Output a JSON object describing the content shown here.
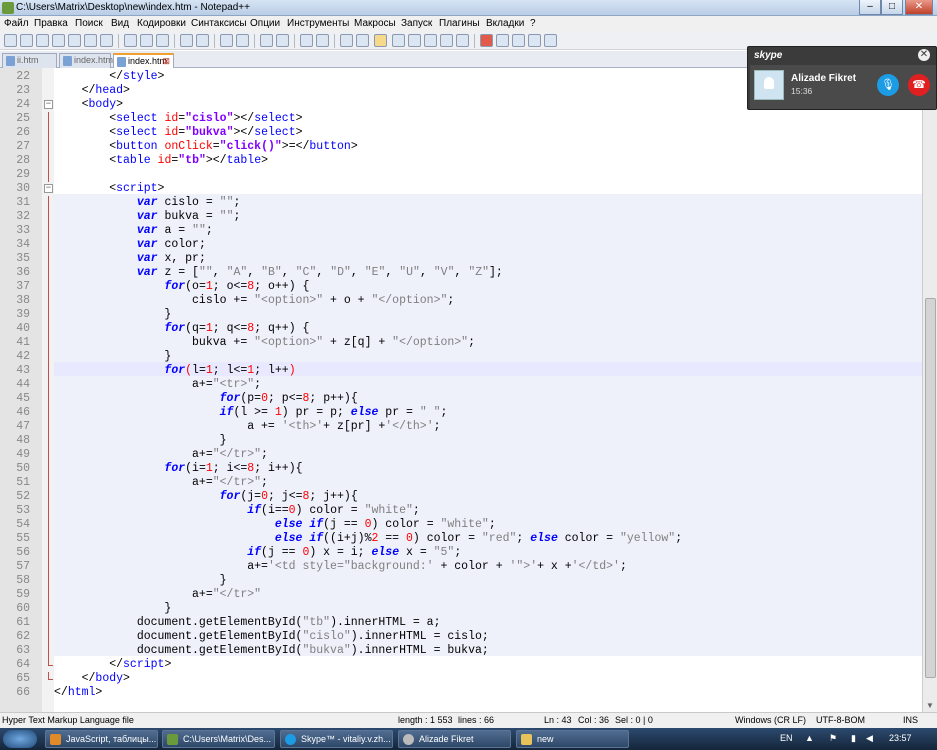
{
  "window": {
    "title": "C:\\Users\\Matrix\\Desktop\\new\\index.htm - Notepad++"
  },
  "menu": [
    "Файл",
    "Правка",
    "Поиск",
    "Вид",
    "Кодировки",
    "Синтаксисы",
    "Опции",
    "Инструменты",
    "Макросы",
    "Запуск",
    "Плагины",
    "Вкладки",
    "?"
  ],
  "tabs": [
    {
      "label": "ii.htm"
    },
    {
      "label": "index.htm"
    },
    {
      "label": "index.htm",
      "active": true
    }
  ],
  "editor": {
    "current_line": 43,
    "lines": [
      {
        "n": 22,
        "html": "        &lt;/<span class='tag'>style</span>&gt;"
      },
      {
        "n": 23,
        "html": "    &lt;/<span class='tag'>head</span>&gt;"
      },
      {
        "n": 24,
        "html": "    &lt;<span class='tag'>body</span>&gt;"
      },
      {
        "n": 25,
        "html": "        &lt;<span class='tag'>select</span> <span class='at'>id</span>=<span class='av'>\"cislo\"</span>&gt;&lt;/<span class='tag'>select</span>&gt;"
      },
      {
        "n": 26,
        "html": "        &lt;<span class='tag'>select</span> <span class='at'>id</span>=<span class='av'>\"bukva\"</span>&gt;&lt;/<span class='tag'>select</span>&gt;"
      },
      {
        "n": 27,
        "html": "        &lt;<span class='tag'>button</span> <span class='at'>onClick</span>=<span class='av'>\"click()\"</span>&gt;=&lt;/<span class='tag'>button</span>&gt;"
      },
      {
        "n": 28,
        "html": "        &lt;<span class='tag'>table</span> <span class='at'>id</span>=<span class='av'>\"tb\"</span>&gt;&lt;/<span class='tag'>table</span>&gt;"
      },
      {
        "n": 29,
        "html": ""
      },
      {
        "n": 30,
        "html": "        &lt;<span class='tag'>script</span>&gt;"
      },
      {
        "n": 31,
        "html": "            <span class='kw'>var</span> cislo = <span class='st'>\"\"</span>;"
      },
      {
        "n": 32,
        "html": "            <span class='kw'>var</span> bukva = <span class='st'>\"\"</span>;"
      },
      {
        "n": 33,
        "html": "            <span class='kw'>var</span> a = <span class='st'>\"\"</span>;"
      },
      {
        "n": 34,
        "html": "            <span class='kw'>var</span> color;"
      },
      {
        "n": 35,
        "html": "            <span class='kw'>var</span> x, pr;"
      },
      {
        "n": 36,
        "html": "            <span class='kw'>var</span> z = [<span class='st'>\"\"</span>, <span class='st'>\"A\"</span>, <span class='st'>\"B\"</span>, <span class='st'>\"C\"</span>, <span class='st'>\"D\"</span>, <span class='st'>\"E\"</span>, <span class='st'>\"U\"</span>, <span class='st'>\"V\"</span>, <span class='st'>\"Z\"</span>];"
      },
      {
        "n": 37,
        "html": "                <span class='kw'>for</span>(o=<span class='nm'>1</span>; o&lt;=<span class='nm'>8</span>; o++) {"
      },
      {
        "n": 38,
        "html": "                    cislo += <span class='st'>\"&lt;option&gt;\"</span> + o + <span class='st'>\"&lt;/option&gt;\"</span>;"
      },
      {
        "n": 39,
        "html": "                }"
      },
      {
        "n": 40,
        "html": "                <span class='kw'>for</span>(q=<span class='nm'>1</span>; q&lt;=<span class='nm'>8</span>; q++) {"
      },
      {
        "n": 41,
        "html": "                    bukva += <span class='st'>\"&lt;option&gt;\"</span> + z[q] + <span class='st'>\"&lt;/option&gt;\"</span>;"
      },
      {
        "n": 42,
        "html": "                }"
      },
      {
        "n": 43,
        "html": "                <span class='kw'>for</span><span class='at'>(</span>l=<span class='nm'>1</span>; l&lt;=<span class='nm'>1</span>; l++<span class='at'>)</span>"
      },
      {
        "n": 44,
        "html": "                    a+=<span class='st'>\"&lt;tr&gt;\"</span>;"
      },
      {
        "n": 45,
        "html": "                        <span class='kw'>for</span>(p=<span class='nm'>0</span>; p&lt;=<span class='nm'>8</span>; p++){"
      },
      {
        "n": 46,
        "html": "                        <span class='kw'>if</span>(l &gt;= <span class='nm'>1</span>) pr = p; <span class='kw'>else</span> pr = <span class='st'>\" \"</span>;"
      },
      {
        "n": 47,
        "html": "                            a += <span class='st'>'&lt;th&gt;'</span>+ z[pr] +<span class='st'>'&lt;/th&gt;'</span>;"
      },
      {
        "n": 48,
        "html": "                        }"
      },
      {
        "n": 49,
        "html": "                    a+=<span class='st'>\"&lt;/tr&gt;\"</span>;"
      },
      {
        "n": 50,
        "html": "                <span class='kw'>for</span>(i=<span class='nm'>1</span>; i&lt;=<span class='nm'>8</span>; i++){"
      },
      {
        "n": 51,
        "html": "                    a+=<span class='st'>\"&lt;/tr&gt;\"</span>;"
      },
      {
        "n": 52,
        "html": "                        <span class='kw'>for</span>(j=<span class='nm'>0</span>; j&lt;=<span class='nm'>8</span>; j++){"
      },
      {
        "n": 53,
        "html": "                            <span class='kw'>if</span>(i==<span class='nm'>0</span>) color = <span class='st'>\"white\"</span>;"
      },
      {
        "n": 54,
        "html": "                                <span class='kw'>else if</span>(j == <span class='nm'>0</span>) color = <span class='st'>\"white\"</span>;"
      },
      {
        "n": 55,
        "html": "                                <span class='kw'>else if</span>((i+j)%<span class='nm'>2</span> == <span class='nm'>0</span>) color = <span class='st'>\"red\"</span>; <span class='kw'>else</span> color = <span class='st'>\"yellow\"</span>;"
      },
      {
        "n": 56,
        "html": "                            <span class='kw'>if</span>(j == <span class='nm'>0</span>) x = i; <span class='kw'>else</span> x = <span class='st'>\"5\"</span>;"
      },
      {
        "n": 57,
        "html": "                            a+=<span class='st'>'&lt;td style=\"background:'</span> + color + <span class='st'>'\"&gt;'</span>+ x +<span class='st'>'&lt;/td&gt;'</span>;"
      },
      {
        "n": 58,
        "html": "                        }"
      },
      {
        "n": 59,
        "html": "                    a+=<span class='st'>\"&lt;/tr&gt;\"</span>"
      },
      {
        "n": 60,
        "html": "                }"
      },
      {
        "n": 61,
        "html": "            document.getElementById(<span class='st'>\"tb\"</span>).innerHTML = a;"
      },
      {
        "n": 62,
        "html": "            document.getElementById(<span class='st'>\"cislo\"</span>).innerHTML = cislo;"
      },
      {
        "n": 63,
        "html": "            document.getElementById(<span class='st'>\"bukva\"</span>).innerHTML = bukva;"
      },
      {
        "n": 64,
        "html": "        &lt;/<span class='tag'>script</span>&gt;"
      },
      {
        "n": 65,
        "html": "    &lt;/<span class='tag'>body</span>&gt;"
      },
      {
        "n": 66,
        "html": "&lt;/<span class='tag'>html</span>&gt;"
      }
    ]
  },
  "status": {
    "filetype": "Hyper Text Markup Language file",
    "length": "length : 1 553",
    "lines": "lines : 66",
    "ln": "Ln : 43",
    "col": "Col : 36",
    "sel": "Sel : 0 | 0",
    "eol": "Windows (CR LF)",
    "encoding": "UTF-8-BOM",
    "mode": "INS"
  },
  "taskbar": {
    "items": [
      "JavaScript, таблицы...",
      "C:\\Users\\Matrix\\Des...",
      "Skype™ - vitaliy.v.zh...",
      "Alizade Fikret",
      "new"
    ],
    "lang": "EN",
    "time": "23:57"
  },
  "skype": {
    "logo": "skype",
    "name": "Alizade Fikret",
    "duration": "15:36"
  }
}
